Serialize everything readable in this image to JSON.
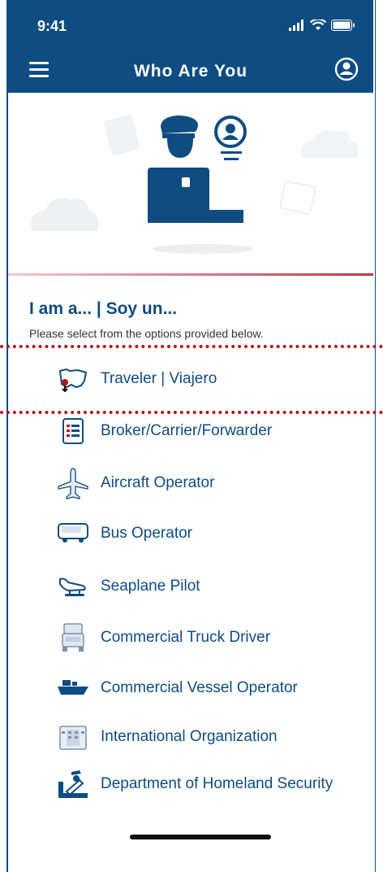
{
  "status_bar": {
    "time": "9:41"
  },
  "nav": {
    "title": "Who Are You"
  },
  "section": {
    "heading": "I am a... | Soy un...",
    "subtext": "Please select from the options provided below."
  },
  "options": [
    {
      "label": "Traveler | Viajero",
      "icon": "map-pin-icon"
    },
    {
      "label": "Broker/Carrier/Forwarder",
      "icon": "document-list-icon"
    },
    {
      "label": "Aircraft Operator",
      "icon": "airplane-icon"
    },
    {
      "label": "Bus Operator",
      "icon": "bus-icon"
    },
    {
      "label": "Seaplane Pilot",
      "icon": "seaplane-icon"
    },
    {
      "label": "Commercial Truck Driver",
      "icon": "truck-icon"
    },
    {
      "label": "Commercial Vessel Operator",
      "icon": "ship-icon"
    },
    {
      "label": "International Organization",
      "icon": "building-icon"
    },
    {
      "label": "Department of Homeland Security",
      "icon": "officer-desk-icon"
    }
  ],
  "colors": {
    "primary": "#0f4c81",
    "accent_red": "#b5121b",
    "divider_red": "#c0344b"
  }
}
